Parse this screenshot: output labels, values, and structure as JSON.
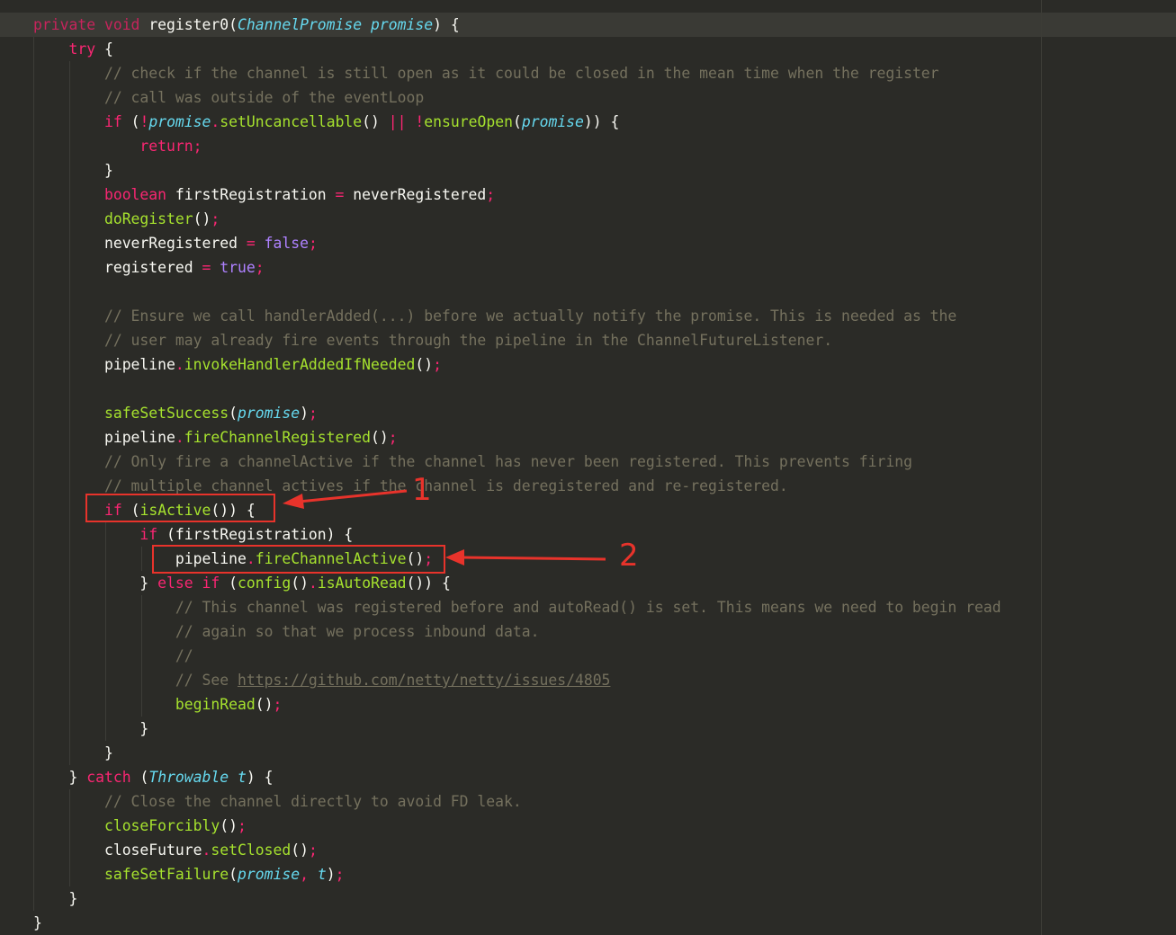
{
  "lines": [
    {
      "indent": 0,
      "tokens": [
        {
          "t": "private",
          "c": "kw-dim"
        },
        {
          "t": " ",
          "c": "id"
        },
        {
          "t": "void",
          "c": "kw-dim"
        },
        {
          "t": " ",
          "c": "id"
        },
        {
          "t": "register0",
          "c": "id"
        },
        {
          "t": "(",
          "c": "punc"
        },
        {
          "t": "ChannelPromise",
          "c": "type"
        },
        {
          "t": " ",
          "c": "id"
        },
        {
          "t": "promise",
          "c": "param"
        },
        {
          "t": ") {",
          "c": "punc"
        }
      ]
    },
    {
      "indent": 1,
      "tokens": [
        {
          "t": "try",
          "c": "kw"
        },
        {
          "t": " {",
          "c": "punc"
        }
      ]
    },
    {
      "indent": 2,
      "tokens": [
        {
          "t": "// check if the channel is still open as it could be closed in the mean time when the register",
          "c": "comment"
        }
      ]
    },
    {
      "indent": 2,
      "tokens": [
        {
          "t": "// call was outside of the eventLoop",
          "c": "comment"
        }
      ]
    },
    {
      "indent": 2,
      "tokens": [
        {
          "t": "if",
          "c": "kw"
        },
        {
          "t": " (",
          "c": "punc"
        },
        {
          "t": "!",
          "c": "op"
        },
        {
          "t": "promise",
          "c": "param"
        },
        {
          "t": ".",
          "c": "op"
        },
        {
          "t": "setUncancellable",
          "c": "fn"
        },
        {
          "t": "() ",
          "c": "punc"
        },
        {
          "t": "||",
          "c": "op"
        },
        {
          "t": " ",
          "c": "id"
        },
        {
          "t": "!",
          "c": "op"
        },
        {
          "t": "ensureOpen",
          "c": "fn"
        },
        {
          "t": "(",
          "c": "punc"
        },
        {
          "t": "promise",
          "c": "param"
        },
        {
          "t": ")) {",
          "c": "punc"
        }
      ]
    },
    {
      "indent": 3,
      "tokens": [
        {
          "t": "return",
          "c": "kw"
        },
        {
          "t": ";",
          "c": "semi"
        }
      ]
    },
    {
      "indent": 2,
      "tokens": [
        {
          "t": "}",
          "c": "punc"
        }
      ]
    },
    {
      "indent": 2,
      "tokens": [
        {
          "t": "boolean",
          "c": "kw"
        },
        {
          "t": " firstRegistration ",
          "c": "id"
        },
        {
          "t": "=",
          "c": "op"
        },
        {
          "t": " neverRegistered",
          "c": "id"
        },
        {
          "t": ";",
          "c": "semi"
        }
      ]
    },
    {
      "indent": 2,
      "tokens": [
        {
          "t": "doRegister",
          "c": "fn"
        },
        {
          "t": "()",
          "c": "punc"
        },
        {
          "t": ";",
          "c": "semi"
        }
      ]
    },
    {
      "indent": 2,
      "tokens": [
        {
          "t": "neverRegistered ",
          "c": "id"
        },
        {
          "t": "=",
          "c": "op"
        },
        {
          "t": " ",
          "c": "id"
        },
        {
          "t": "false",
          "c": "const"
        },
        {
          "t": ";",
          "c": "semi"
        }
      ]
    },
    {
      "indent": 2,
      "tokens": [
        {
          "t": "registered ",
          "c": "id"
        },
        {
          "t": "=",
          "c": "op"
        },
        {
          "t": " ",
          "c": "id"
        },
        {
          "t": "true",
          "c": "const"
        },
        {
          "t": ";",
          "c": "semi"
        }
      ]
    },
    {
      "indent": 2,
      "tokens": []
    },
    {
      "indent": 2,
      "tokens": [
        {
          "t": "// Ensure we call handlerAdded(...) before we actually notify the promise. This is needed as the",
          "c": "comment"
        }
      ]
    },
    {
      "indent": 2,
      "tokens": [
        {
          "t": "// user may already fire events through the pipeline in the ChannelFutureListener.",
          "c": "comment"
        }
      ]
    },
    {
      "indent": 2,
      "tokens": [
        {
          "t": "pipeline",
          "c": "id"
        },
        {
          "t": ".",
          "c": "op"
        },
        {
          "t": "invokeHandlerAddedIfNeeded",
          "c": "fn"
        },
        {
          "t": "()",
          "c": "punc"
        },
        {
          "t": ";",
          "c": "semi"
        }
      ]
    },
    {
      "indent": 2,
      "tokens": []
    },
    {
      "indent": 2,
      "tokens": [
        {
          "t": "safeSetSuccess",
          "c": "fn"
        },
        {
          "t": "(",
          "c": "punc"
        },
        {
          "t": "promise",
          "c": "param"
        },
        {
          "t": ")",
          "c": "punc"
        },
        {
          "t": ";",
          "c": "semi"
        }
      ]
    },
    {
      "indent": 2,
      "tokens": [
        {
          "t": "pipeline",
          "c": "id"
        },
        {
          "t": ".",
          "c": "op"
        },
        {
          "t": "fireChannelRegistered",
          "c": "fn"
        },
        {
          "t": "()",
          "c": "punc"
        },
        {
          "t": ";",
          "c": "semi"
        }
      ]
    },
    {
      "indent": 2,
      "tokens": [
        {
          "t": "// Only fire a channelActive if the channel has never been registered. This prevents firing",
          "c": "comment"
        }
      ]
    },
    {
      "indent": 2,
      "tokens": [
        {
          "t": "// multiple channel actives if the channel is deregistered and re-registered.",
          "c": "comment"
        }
      ]
    },
    {
      "indent": 2,
      "tokens": [
        {
          "t": "if",
          "c": "kw"
        },
        {
          "t": " (",
          "c": "punc"
        },
        {
          "t": "isActive",
          "c": "fn"
        },
        {
          "t": "()) {",
          "c": "punc"
        }
      ]
    },
    {
      "indent": 3,
      "tokens": [
        {
          "t": "if",
          "c": "kw"
        },
        {
          "t": " (firstRegistration) {",
          "c": "punc"
        }
      ]
    },
    {
      "indent": 4,
      "tokens": [
        {
          "t": "pipeline",
          "c": "id"
        },
        {
          "t": ".",
          "c": "op"
        },
        {
          "t": "fireChannelActive",
          "c": "fn"
        },
        {
          "t": "()",
          "c": "punc"
        },
        {
          "t": ";",
          "c": "semi"
        }
      ]
    },
    {
      "indent": 3,
      "tokens": [
        {
          "t": "} ",
          "c": "punc"
        },
        {
          "t": "else",
          "c": "kw"
        },
        {
          "t": " ",
          "c": "id"
        },
        {
          "t": "if",
          "c": "kw"
        },
        {
          "t": " (",
          "c": "punc"
        },
        {
          "t": "config",
          "c": "fn"
        },
        {
          "t": "()",
          "c": "punc"
        },
        {
          "t": ".",
          "c": "op"
        },
        {
          "t": "isAutoRead",
          "c": "fn"
        },
        {
          "t": "()) {",
          "c": "punc"
        }
      ]
    },
    {
      "indent": 4,
      "tokens": [
        {
          "t": "// This channel was registered before and autoRead() is set. This means we need to begin read",
          "c": "comment"
        }
      ]
    },
    {
      "indent": 4,
      "tokens": [
        {
          "t": "// again so that we process inbound data.",
          "c": "comment"
        }
      ]
    },
    {
      "indent": 4,
      "tokens": [
        {
          "t": "//",
          "c": "comment"
        }
      ]
    },
    {
      "indent": 4,
      "tokens": [
        {
          "t": "// See ",
          "c": "comment"
        },
        {
          "t": "https://github.com/netty/netty/issues/4805",
          "c": "link"
        }
      ]
    },
    {
      "indent": 4,
      "tokens": [
        {
          "t": "beginRead",
          "c": "fn"
        },
        {
          "t": "()",
          "c": "punc"
        },
        {
          "t": ";",
          "c": "semi"
        }
      ]
    },
    {
      "indent": 3,
      "tokens": [
        {
          "t": "}",
          "c": "punc"
        }
      ]
    },
    {
      "indent": 2,
      "tokens": [
        {
          "t": "}",
          "c": "punc"
        }
      ]
    },
    {
      "indent": 1,
      "tokens": [
        {
          "t": "} ",
          "c": "punc"
        },
        {
          "t": "catch",
          "c": "kw"
        },
        {
          "t": " (",
          "c": "punc"
        },
        {
          "t": "Throwable",
          "c": "type"
        },
        {
          "t": " ",
          "c": "id"
        },
        {
          "t": "t",
          "c": "param"
        },
        {
          "t": ") {",
          "c": "punc"
        }
      ]
    },
    {
      "indent": 2,
      "tokens": [
        {
          "t": "// Close the channel directly to avoid FD leak.",
          "c": "comment"
        }
      ]
    },
    {
      "indent": 2,
      "tokens": [
        {
          "t": "closeForcibly",
          "c": "fn"
        },
        {
          "t": "()",
          "c": "punc"
        },
        {
          "t": ";",
          "c": "semi"
        }
      ]
    },
    {
      "indent": 2,
      "tokens": [
        {
          "t": "closeFuture",
          "c": "id"
        },
        {
          "t": ".",
          "c": "op"
        },
        {
          "t": "setClosed",
          "c": "fn"
        },
        {
          "t": "()",
          "c": "punc"
        },
        {
          "t": ";",
          "c": "semi"
        }
      ]
    },
    {
      "indent": 2,
      "tokens": [
        {
          "t": "safeSetFailure",
          "c": "fn"
        },
        {
          "t": "(",
          "c": "punc"
        },
        {
          "t": "promise",
          "c": "param"
        },
        {
          "t": ", ",
          "c": "op"
        },
        {
          "t": "t",
          "c": "param"
        },
        {
          "t": ")",
          "c": "punc"
        },
        {
          "t": ";",
          "c": "semi"
        }
      ]
    },
    {
      "indent": 1,
      "tokens": [
        {
          "t": "}",
          "c": "punc"
        }
      ]
    },
    {
      "indent": 0,
      "tokens": [
        {
          "t": "}",
          "c": "punc"
        }
      ]
    }
  ],
  "annotations": {
    "label_1": "1",
    "label_2": "2",
    "color": "#e8332b"
  },
  "colors": {
    "background": "#2b2b27",
    "keyword": "#f92672",
    "function": "#a6e22e",
    "type": "#66d9ef",
    "constant": "#ae81ff",
    "comment": "#75715e",
    "text": "#f8f8f2"
  }
}
